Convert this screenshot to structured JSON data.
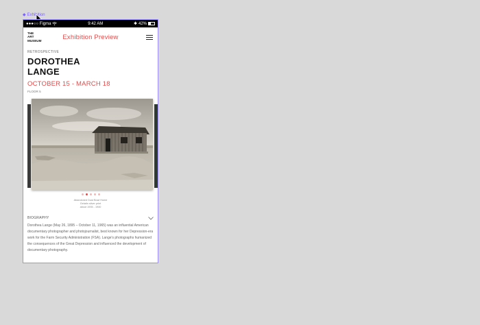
{
  "figma": {
    "frame_label": "Exhibition",
    "frame_icon": "diamond-icon"
  },
  "statusbar": {
    "carrier": "●●●○○ Figma",
    "wifi_icon": "wifi-icon",
    "time": "9:42 AM",
    "bluetooth_icon": "bluetooth-icon",
    "battery_percent": "42%",
    "battery_level": 0.42
  },
  "header": {
    "logo_line1": "THE",
    "logo_line2": "ART",
    "logo_line3": "MUSEUM",
    "title": "Exhibition Preview",
    "menu_icon": "hamburger-menu-icon"
  },
  "exhibit": {
    "eyebrow": "RETROSPECTIVE",
    "title_line1": "DOROTHEA",
    "title_line2": "LANGE",
    "dates": "OCTOBER 15 - MARCH 18",
    "floor": "FLOOR 5"
  },
  "carousel": {
    "image_description_icon": "photo-abandoned-house-icon",
    "slide_count": 5,
    "active_index": 1,
    "caption_line1": "Abandoned Dust Bowl Home",
    "caption_line2": "Gelatin silver print",
    "caption_line3": "about 1935 - 1940"
  },
  "biography": {
    "label": "BIOGRAPHY",
    "text": "Dorothea Lange (May 26, 1895 – October 11, 1965) was an influential American documentary photographer and photojournalist, best known for her Depression-era work for the Farm Security Administration (FSA). Lange's photographs humanized the consequences of the Great Depression and influenced the development of documentary photography."
  },
  "colors": {
    "accent": "#e24b4b",
    "frame_border": "#9b8cff",
    "canvas": "#d9d9d9"
  }
}
